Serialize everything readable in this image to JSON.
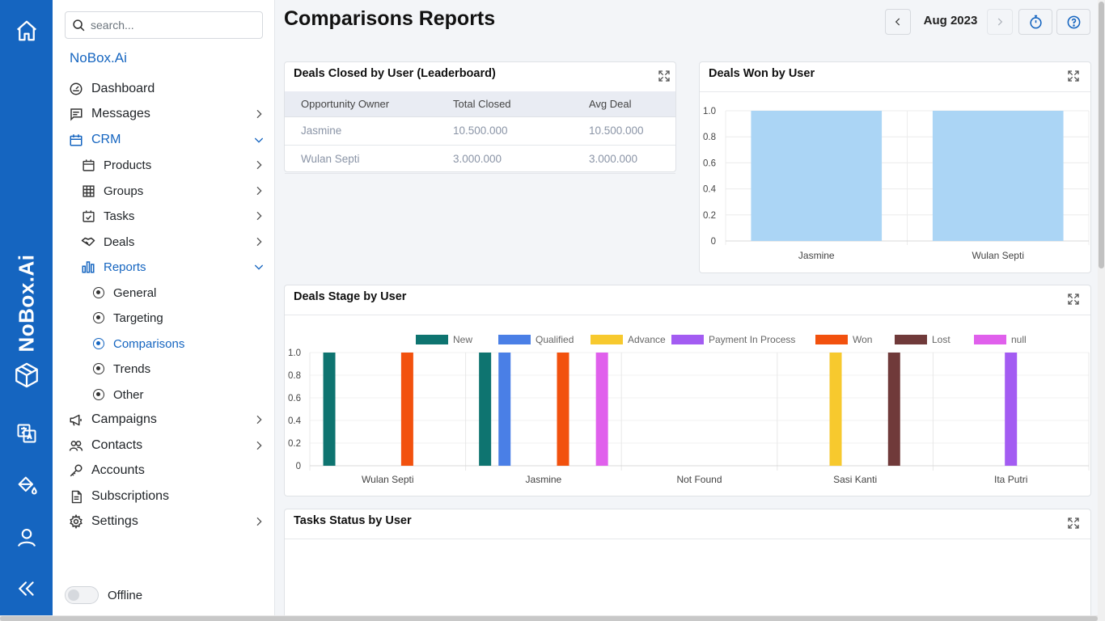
{
  "rail": {
    "brand": "NoBox.Ai",
    "icons": [
      "home-icon",
      "box-logo-icon",
      "translate-icon",
      "paint-bucket-icon",
      "user-icon",
      "collapse-icon"
    ]
  },
  "sidebar": {
    "search_placeholder": "search...",
    "org_name": "NoBox.Ai",
    "items": {
      "dashboard": "Dashboard",
      "messages": "Messages",
      "crm": "CRM",
      "products": "Products",
      "groups": "Groups",
      "tasks": "Tasks",
      "deals": "Deals",
      "reports": "Reports",
      "general": "General",
      "targeting": "Targeting",
      "comparisons": "Comparisons",
      "trends": "Trends",
      "other": "Other",
      "campaigns": "Campaigns",
      "contacts": "Contacts",
      "accounts": "Accounts",
      "subscriptions": "Subscriptions",
      "settings": "Settings"
    },
    "offline_label": "Offline",
    "accent": "#1565c0"
  },
  "header": {
    "title": "Comparisons Reports",
    "period": "Aug 2023"
  },
  "leaderboard": {
    "title": "Deals Closed by User (Leaderboard)",
    "columns": [
      "Opportunity Owner",
      "Total Closed",
      "Avg Deal"
    ],
    "rows": [
      [
        "Jasmine",
        "10.500.000",
        "10.500.000"
      ],
      [
        "Wulan Septi",
        "3.000.000",
        "3.000.000"
      ]
    ]
  },
  "deals_won": {
    "title": "Deals Won by User"
  },
  "deals_stage": {
    "title": "Deals Stage by User"
  },
  "tasks_status": {
    "title": "Tasks Status by User"
  },
  "chart_data": [
    {
      "type": "bar",
      "title": "Deals Won by User",
      "categories": [
        "Jasmine",
        "Wulan Septi"
      ],
      "values": [
        1,
        1
      ],
      "ylim": [
        0,
        1
      ],
      "yticks": [
        "0",
        "0.2",
        "0.4",
        "0.6",
        "0.8",
        "1.0"
      ],
      "color": "#abd5f5"
    },
    {
      "type": "bar",
      "title": "Deals Stage by User",
      "categories": [
        "Wulan Septi",
        "Jasmine",
        "Not Found",
        "Sasi Kanti",
        "Ita Putri"
      ],
      "ylim": [
        0,
        1
      ],
      "yticks": [
        "0",
        "0.2",
        "0.4",
        "0.6",
        "0.8",
        "1.0"
      ],
      "legend_position": "top",
      "series": [
        {
          "name": "New",
          "color": "#0e7470",
          "values": [
            1,
            1,
            0,
            0,
            0
          ]
        },
        {
          "name": "Qualified",
          "color": "#4a7fe6",
          "values": [
            0,
            1,
            0,
            0,
            0
          ]
        },
        {
          "name": "Advance",
          "color": "#f7c92e",
          "values": [
            0,
            0,
            0,
            1,
            0
          ]
        },
        {
          "name": "Payment In Process",
          "color": "#a35cf2",
          "values": [
            0,
            0,
            0,
            0,
            1
          ]
        },
        {
          "name": "Won",
          "color": "#f2510e",
          "values": [
            1,
            1,
            0,
            0,
            0
          ]
        },
        {
          "name": "Lost",
          "color": "#703a3a",
          "values": [
            0,
            0,
            0,
            1,
            0
          ]
        },
        {
          "name": "null",
          "color": "#e060ec",
          "values": [
            0,
            1,
            0,
            0,
            0
          ]
        }
      ]
    }
  ]
}
